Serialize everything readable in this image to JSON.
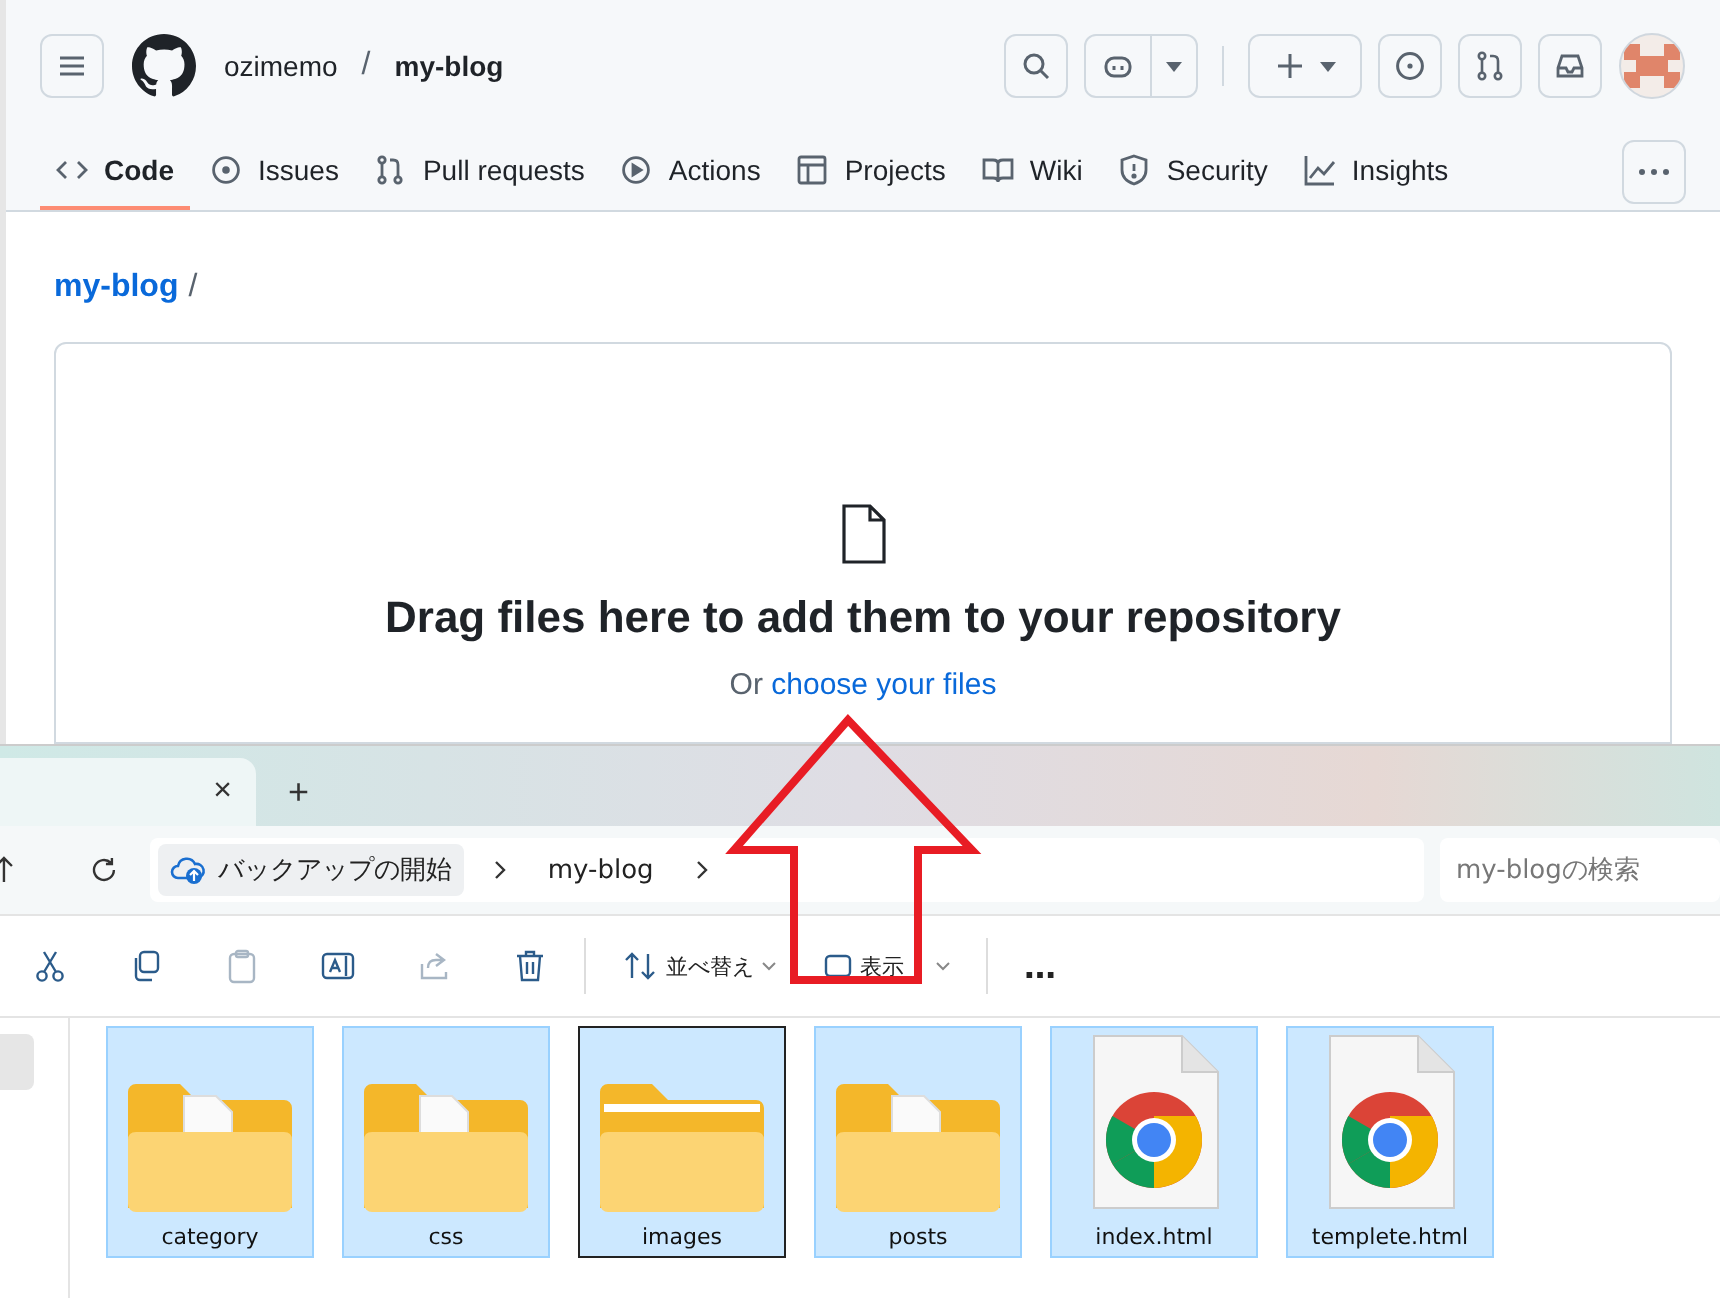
{
  "github": {
    "owner": "ozimemo",
    "separator": "/",
    "repo": "my-blog",
    "tabs": [
      {
        "kind": "code",
        "label": "Code",
        "selected": true
      },
      {
        "kind": "issues",
        "label": "Issues",
        "selected": false
      },
      {
        "kind": "pulls",
        "label": "Pull requests",
        "selected": false
      },
      {
        "kind": "actions",
        "label": "Actions",
        "selected": false
      },
      {
        "kind": "projects",
        "label": "Projects",
        "selected": false
      },
      {
        "kind": "wiki",
        "label": "Wiki",
        "selected": false
      },
      {
        "kind": "security",
        "label": "Security",
        "selected": false
      },
      {
        "kind": "insights",
        "label": "Insights",
        "selected": false
      }
    ],
    "breadcrumb": {
      "repo": "my-blog",
      "separator": "/"
    },
    "upload": {
      "heading": "Drag files here to add them to your repository",
      "prefix": "Or",
      "link": "choose your files"
    }
  },
  "explorer": {
    "tab_close": "×",
    "new_tab": "+",
    "address": [
      "バックアップの開始",
      "my-blog"
    ],
    "search": {
      "placeholder": "my-blogの検索"
    },
    "toolbar": [
      {
        "kind": "cut",
        "disabled": false
      },
      {
        "kind": "copy",
        "disabled": false
      },
      {
        "kind": "paste",
        "disabled": true
      },
      {
        "kind": "rename",
        "disabled": false
      },
      {
        "kind": "share",
        "disabled": true
      },
      {
        "kind": "delete",
        "disabled": false
      },
      {
        "kind": "sort",
        "label": "並べ替え",
        "disabled": false
      },
      {
        "kind": "view",
        "label": "表示",
        "disabled": false
      },
      {
        "kind": "more",
        "label": "…",
        "disabled": false
      }
    ],
    "files": [
      {
        "name": "category",
        "kind": "folder-page",
        "selected": true,
        "focused": false
      },
      {
        "name": "css",
        "kind": "folder-code",
        "selected": true,
        "focused": false
      },
      {
        "name": "images",
        "kind": "folder",
        "selected": true,
        "focused": true
      },
      {
        "name": "posts",
        "kind": "folder-page",
        "selected": true,
        "focused": false
      },
      {
        "name": "index.html",
        "kind": "chrome-file",
        "selected": true,
        "focused": false
      },
      {
        "name": "templete.html",
        "kind": "chrome-file",
        "selected": true,
        "focused": false
      }
    ]
  }
}
